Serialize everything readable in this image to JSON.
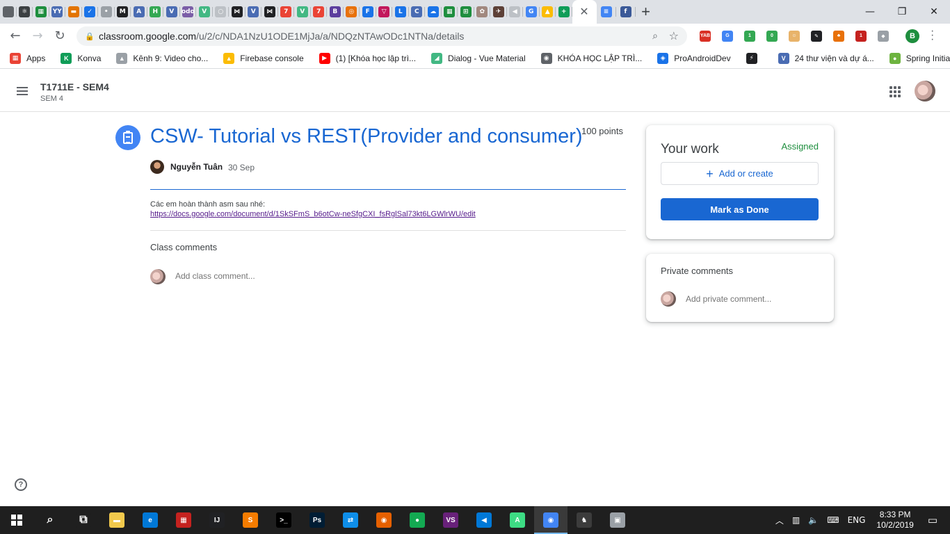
{
  "browser": {
    "tab_favicons": [
      {
        "name": "tab-favicon-1",
        "glyph": "",
        "color": "#5f6368"
      },
      {
        "name": "tab-favicon-2",
        "glyph": "⚛",
        "color": "#3c4043"
      },
      {
        "name": "tab-favicon-3",
        "glyph": "▦",
        "color": "#1e8e3e"
      },
      {
        "name": "tab-favicon-4",
        "glyph": "YY",
        "color": "#4a6cb3"
      },
      {
        "name": "tab-favicon-5",
        "glyph": "▬",
        "color": "#e37400"
      },
      {
        "name": "tab-favicon-6",
        "glyph": "✓",
        "color": "#1a73e8"
      },
      {
        "name": "tab-favicon-7",
        "glyph": "•",
        "color": "#9aa0a6"
      },
      {
        "name": "tab-favicon-8",
        "glyph": "M",
        "color": "#202124"
      },
      {
        "name": "tab-favicon-9",
        "glyph": "A",
        "color": "#4a6cb3"
      },
      {
        "name": "tab-favicon-10",
        "glyph": "H",
        "color": "#34a853"
      },
      {
        "name": "tab-favicon-11",
        "glyph": "V",
        "color": "#4a6cb3"
      },
      {
        "name": "tab-favicon-12",
        "glyph": "odo",
        "color": "#7b5ea7"
      },
      {
        "name": "tab-favicon-13",
        "glyph": "V",
        "color": "#42b883"
      },
      {
        "name": "tab-favicon-14",
        "glyph": "○",
        "color": "#bdc1c6"
      },
      {
        "name": "tab-favicon-15",
        "glyph": "⋈",
        "color": "#202124"
      },
      {
        "name": "tab-favicon-16",
        "glyph": "V",
        "color": "#4a6cb3"
      },
      {
        "name": "tab-favicon-17",
        "glyph": "⋈",
        "color": "#202124"
      },
      {
        "name": "tab-favicon-18",
        "glyph": "7",
        "color": "#ea4335"
      },
      {
        "name": "tab-favicon-19",
        "glyph": "V",
        "color": "#42b883"
      },
      {
        "name": "tab-favicon-20",
        "glyph": "7",
        "color": "#ea4335"
      },
      {
        "name": "tab-favicon-21",
        "glyph": "B",
        "color": "#5c3e9e"
      },
      {
        "name": "tab-favicon-22",
        "glyph": "◎",
        "color": "#e8710a"
      },
      {
        "name": "tab-favicon-23",
        "glyph": "F",
        "color": "#1a73e8"
      },
      {
        "name": "tab-favicon-24",
        "glyph": "▽",
        "color": "#c2185b"
      },
      {
        "name": "tab-favicon-25",
        "glyph": "L",
        "color": "#1a73e8"
      },
      {
        "name": "tab-favicon-26",
        "glyph": "C",
        "color": "#4a6cb3"
      },
      {
        "name": "tab-favicon-27",
        "glyph": "☁",
        "color": "#1a73e8"
      },
      {
        "name": "tab-favicon-28",
        "glyph": "▦",
        "color": "#1e8e3e"
      },
      {
        "name": "tab-favicon-29",
        "glyph": "⊞",
        "color": "#1e8e3e"
      },
      {
        "name": "tab-favicon-30",
        "glyph": "✿",
        "color": "#a1887f"
      },
      {
        "name": "tab-favicon-31",
        "glyph": "✈",
        "color": "#5d4037"
      },
      {
        "name": "tab-favicon-32",
        "glyph": "◀",
        "color": "#bdc1c6"
      },
      {
        "name": "tab-favicon-33",
        "glyph": "G",
        "color": "#4285f4"
      },
      {
        "name": "tab-favicon-34",
        "glyph": "▲",
        "color": "#fbbc04"
      },
      {
        "name": "tab-favicon-35",
        "glyph": "+",
        "color": "#0f9d58"
      }
    ],
    "active_tab_close": "✕",
    "after_tabs": [
      {
        "name": "tab-favicon-docs",
        "glyph": "≡",
        "color": "#4285f4"
      },
      {
        "name": "tab-favicon-facebook",
        "glyph": "f",
        "color": "#3b5998"
      }
    ],
    "new_tab_glyph": "+",
    "window_controls": {
      "minimize": "—",
      "restore": "❐",
      "close": "✕"
    },
    "nav": {
      "back": "←",
      "forward": "→",
      "reload": "↻"
    },
    "url_host": "classroom.google.com",
    "url_path": "/u/2/c/NDA1NzU1ODE1MjJa/a/NDQzNTAwODc1NTNa/details",
    "extensions": [
      {
        "name": "yab-extension-icon",
        "glyph": "YAB",
        "color": "#d93025"
      },
      {
        "name": "translate-extension-icon",
        "glyph": "G",
        "color": "#4285f4"
      },
      {
        "name": "shield-extension-icon",
        "glyph": "1",
        "color": "#34a853"
      },
      {
        "name": "check-extension-icon",
        "glyph": "0",
        "color": "#34a853"
      },
      {
        "name": "face-extension-icon",
        "glyph": "☺",
        "color": "#e8b36a"
      },
      {
        "name": "pen-extension-icon",
        "glyph": "✎",
        "color": "#202124"
      },
      {
        "name": "fox-extension-icon",
        "glyph": "♣",
        "color": "#e8710a"
      },
      {
        "name": "ublock-extension-icon",
        "glyph": "1",
        "color": "#c5221f"
      },
      {
        "name": "cube-extension-icon",
        "glyph": "◆",
        "color": "#9aa0a6"
      }
    ],
    "profile_letter": "B",
    "bookmarks": [
      {
        "name": "bookmark-apps",
        "label": "Apps",
        "glyph": "▦",
        "color": "#ea4335"
      },
      {
        "name": "bookmark-konva",
        "label": "Konva",
        "glyph": "K",
        "color": "#0f9d58"
      },
      {
        "name": "bookmark-kenh9",
        "label": "Kênh 9: Video cho...",
        "glyph": "▲",
        "color": "#9aa0a6"
      },
      {
        "name": "bookmark-firebase",
        "label": "Firebase console",
        "glyph": "▲",
        "color": "#fbbc04"
      },
      {
        "name": "bookmark-youtube",
        "label": "(1) [Khóa học lập trì...",
        "glyph": "▶",
        "color": "#ff0000"
      },
      {
        "name": "bookmark-dialog",
        "label": "Dialog - Vue Material",
        "glyph": "◢",
        "color": "#42b883"
      },
      {
        "name": "bookmark-khoahoc",
        "label": "KHÓA HỌC LẬP TRÌ...",
        "glyph": "◉",
        "color": "#5f6368"
      },
      {
        "name": "bookmark-proandroiddev",
        "label": "ProAndroidDev",
        "glyph": "◈",
        "color": "#1a73e8"
      },
      {
        "name": "bookmark-blank",
        "label": "",
        "glyph": "⚡",
        "color": "#202124"
      },
      {
        "name": "bookmark-24thuvien",
        "label": "24 thư viện và dự á...",
        "glyph": "V",
        "color": "#4a6cb3"
      },
      {
        "name": "bookmark-spring",
        "label": "Spring Initializr",
        "glyph": "●",
        "color": "#6db33f"
      }
    ]
  },
  "classroom": {
    "class_name": "T1711E - SEM4",
    "section": "SEM 4",
    "assignment_title": "CSW- Tutorial vs REST(Provider and consumer)",
    "points": "100 points",
    "author": "Nguyễn Tuân",
    "date": "30 Sep",
    "description": "Các em hoàn thành asm sau nhé:",
    "link": "https://docs.google.com/document/d/1SkSFmS_b6otCw-neSfgCXI_fsRglSal73kt6LGWlrWU/edit",
    "class_comments_title": "Class comments",
    "class_comment_placeholder": "Add class comment...",
    "your_work_title": "Your work",
    "status": "Assigned",
    "add_or_create_label": "Add or create",
    "mark_done_label": "Mark as Done",
    "private_comments_title": "Private comments",
    "private_comment_placeholder": "Add private comment...",
    "help_glyph": "?",
    "colors": {
      "accent": "#1967d2",
      "assigned_green": "#1e8e3e",
      "assignment_icon_bg": "#4285f4"
    }
  },
  "taskbar": {
    "apps": [
      {
        "name": "search-icon",
        "glyph": "⌕",
        "color": "#1f1f1f"
      },
      {
        "name": "task-view-icon",
        "glyph": "⧉",
        "color": "#1f1f1f"
      },
      {
        "name": "file-explorer-icon",
        "glyph": "▬",
        "color": "#f2c94c"
      },
      {
        "name": "edge-icon",
        "glyph": "e",
        "color": "#0078d7"
      },
      {
        "name": "app-red-icon",
        "glyph": "▦",
        "color": "#c5221f"
      },
      {
        "name": "intellij-icon",
        "glyph": "IJ",
        "color": "#202124"
      },
      {
        "name": "sublime-icon",
        "glyph": "S",
        "color": "#f57c00"
      },
      {
        "name": "terminal-icon",
        "glyph": ">_",
        "color": "#000000"
      },
      {
        "name": "photoshop-icon",
        "glyph": "Ps",
        "color": "#001d34"
      },
      {
        "name": "teamviewer-icon",
        "glyph": "⇄",
        "color": "#0e8ee9"
      },
      {
        "name": "firefox-icon",
        "glyph": "◉",
        "color": "#e66000"
      },
      {
        "name": "mongodb-icon",
        "glyph": "●",
        "color": "#13aa52"
      },
      {
        "name": "visual-studio-icon",
        "glyph": "VS",
        "color": "#68217a"
      },
      {
        "name": "vscode-icon",
        "glyph": "◀",
        "color": "#0078d7"
      },
      {
        "name": "android-studio-icon",
        "glyph": "A",
        "color": "#3ddc84"
      },
      {
        "name": "chrome-icon",
        "glyph": "◉",
        "color": "#4285f4"
      },
      {
        "name": "app-dark-icon",
        "glyph": "♞",
        "color": "#3c3c3c"
      },
      {
        "name": "app-photo-icon",
        "glyph": "▣",
        "color": "#9aa0a6"
      }
    ],
    "tray": {
      "chevron": "︿",
      "network": "▥",
      "volume": "🔈",
      "ime": "⌨",
      "language": "ENG",
      "notification": "▭"
    },
    "time": "8:33 PM",
    "date": "10/2/2019"
  }
}
